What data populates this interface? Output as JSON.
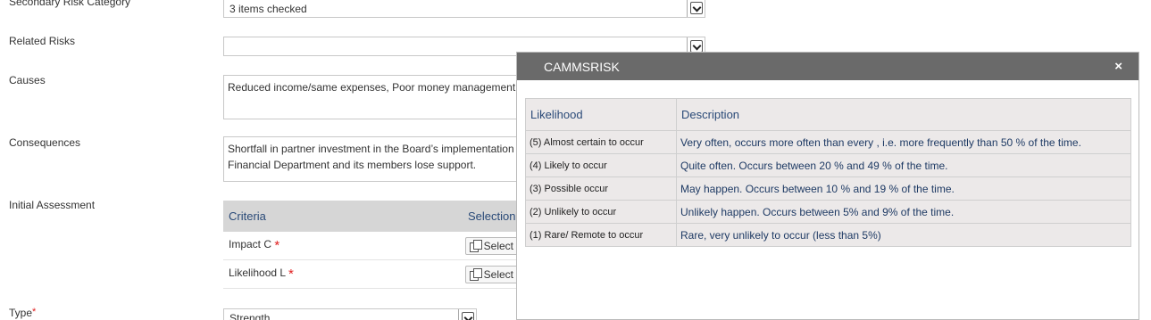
{
  "form": {
    "secondary_risk_category": {
      "label": "Secondary Risk Category",
      "value": "3 items checked"
    },
    "related_risks": {
      "label": "Related Risks",
      "value": ""
    },
    "causes": {
      "label": "Causes",
      "value": "Reduced income/same expenses, Poor money management"
    },
    "consequences": {
      "label": "Consequences",
      "line1": "Shortfall in partner investment in the Board’s implementation",
      "line2": "Financial Department and its members lose support."
    },
    "initial_assessment": {
      "label": "Initial Assessment",
      "headers": {
        "criteria": "Criteria",
        "selection": "Selection"
      },
      "rows": [
        {
          "label": "Impact C",
          "required": "*",
          "button": "Select"
        },
        {
          "label": "Likelihood L",
          "required": "*",
          "button": "Select"
        }
      ]
    },
    "type": {
      "label": "Type",
      "required": "*",
      "value": "Strength"
    }
  },
  "modal": {
    "title": "CAMMSRISK",
    "close": "×",
    "headers": {
      "likelihood": "Likelihood",
      "description": "Description"
    },
    "rows": [
      {
        "likelihood": "(5) Almost certain to occur",
        "description": "Very often, occurs more often than every , i.e. more frequently than 50 % of the time."
      },
      {
        "likelihood": "(4) Likely to occur",
        "description": "Quite often. Occurs between 20 % and 49 % of the time."
      },
      {
        "likelihood": "(3) Possible occur",
        "description": "May happen. Occurs between 10 % and 19 % of the time."
      },
      {
        "likelihood": "(2) Unlikely to occur",
        "description": "Unlikely happen. Occurs between 5% and 9% of the time."
      },
      {
        "likelihood": "(1) Rare/ Remote to occur",
        "description": "Rare, very unlikely to occur (less than 5%)"
      }
    ]
  },
  "colors": {
    "modal_header": "#6a6a6a",
    "table_bg": "#ece9e9",
    "heading_text": "#2a4a78",
    "required": "#e02020"
  },
  "icons": {
    "dropdown": "chevron-down-icon",
    "select": "copy-icon",
    "close": "close-icon"
  }
}
